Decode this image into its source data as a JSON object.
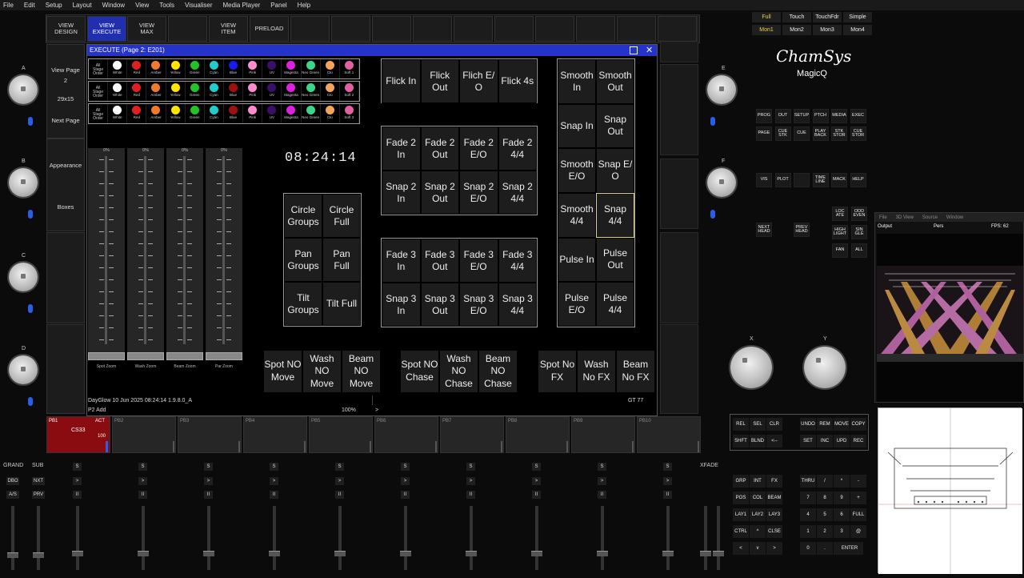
{
  "menu": [
    "File",
    "Edit",
    "Setup",
    "Layout",
    "Window",
    "View",
    "Tools",
    "Visualiser",
    "Media Player",
    "Panel",
    "Help"
  ],
  "top_buttons": [
    {
      "label": "VIEW\nDESIGN",
      "active": false
    },
    {
      "label": "VIEW\nEXECUTE",
      "active": true
    },
    {
      "label": "VIEW\nMAX",
      "active": false
    },
    {
      "label": "",
      "active": false
    },
    {
      "label": "VIEW\nITEM",
      "active": false
    },
    {
      "label": "PRELOAD",
      "active": false
    }
  ],
  "left_panel": {
    "view_page": "View Page",
    "page_num": "2",
    "size": "29x15",
    "next_page": "Next Page",
    "appearance": "Appearance",
    "boxes": "Boxes"
  },
  "encoders_left": [
    "A",
    "B",
    "C",
    "D"
  ],
  "encoders_right": [
    "E",
    "F"
  ],
  "encoders_xy": [
    "X",
    "Y"
  ],
  "exec_window": {
    "title": "EXECUTE (Page 2:  E201)"
  },
  "colour_rows": [
    {
      "first": "All\nStage\nOrder",
      "items": [
        [
          "White",
          "#ffffff"
        ],
        [
          "Red",
          "#e02020"
        ],
        [
          "Amber",
          "#f07a2a"
        ],
        [
          "Yellow",
          "#ffe400"
        ],
        [
          "Green",
          "#22c22a"
        ],
        [
          "Cyan",
          "#22cccc"
        ],
        [
          "Blue",
          "#1a1aee"
        ],
        [
          "Pink",
          "#ff8ccf"
        ],
        [
          "UV",
          "#3a0f6a"
        ],
        [
          "Magenta",
          "#e020e0"
        ],
        [
          "Neo Green",
          "#3cd68a"
        ],
        [
          "Cto",
          "#f5a55a"
        ],
        [
          "Soft 1",
          "#e060a0"
        ]
      ]
    },
    {
      "first": "All\nStage\nOrder",
      "items": [
        [
          "White",
          "#ffffff"
        ],
        [
          "Red",
          "#e02020"
        ],
        [
          "Amber",
          "#f07a2a"
        ],
        [
          "Yellow",
          "#ffe400"
        ],
        [
          "Green",
          "#22c22a"
        ],
        [
          "Cyan",
          "#22cccc"
        ],
        [
          "Blue",
          "#a01010"
        ],
        [
          "Pink",
          "#ff8ccf"
        ],
        [
          "UV",
          "#3a0f6a"
        ],
        [
          "Magenta",
          "#e020e0"
        ],
        [
          "Neo Green",
          "#3cd68a"
        ],
        [
          "Cto",
          "#f5a55a"
        ],
        [
          "Soft 2",
          "#e060a0"
        ]
      ]
    },
    {
      "first": "All\nStage\nOrder",
      "items": [
        [
          "White",
          "#ffffff"
        ],
        [
          "Red",
          "#e02020"
        ],
        [
          "Amber",
          "#f07a2a"
        ],
        [
          "Yellow",
          "#ffe400"
        ],
        [
          "Green",
          "#22c22a"
        ],
        [
          "Cyan",
          "#22cccc"
        ],
        [
          "Blue",
          "#a01010"
        ],
        [
          "Pink",
          "#ff8ccf"
        ],
        [
          "UV",
          "#3a0f6a"
        ],
        [
          "Magenta",
          "#e020e0"
        ],
        [
          "Neo Green",
          "#3cd68a"
        ],
        [
          "Cto",
          "#f5a55a"
        ],
        [
          "Soft 3",
          "#e060a0"
        ]
      ]
    }
  ],
  "faders": [
    {
      "pct": "0%",
      "label": "Spot Zoom"
    },
    {
      "pct": "0%",
      "label": "Wash Zoom"
    },
    {
      "pct": "0%",
      "label": "Beam Zoom"
    },
    {
      "pct": "0%",
      "label": "Par Zoom"
    }
  ],
  "clock": "08:24:14",
  "groups": [
    "Circle\nGroups",
    "Circle\nFull",
    "Pan\nGroups",
    "Pan\nFull",
    "Tilt\nGroups",
    "Tilt Full"
  ],
  "flick": [
    "Flick In",
    "Flick\nOut",
    "Flich E/\nO",
    "Flick 4s"
  ],
  "fade2": [
    "Fade 2\nIn",
    "Fade 2\nOut",
    "Fade 2\nE/O",
    "Fade 2\n4/4",
    "Snap 2\nIn",
    "Snap 2\nOut",
    "Snap 2\nE/O",
    "Snap 2\n4/4"
  ],
  "fade3": [
    "Fade 3\nIn",
    "Fade 3\nOut",
    "Fade 3\nE/O",
    "Fade 3\n4/4",
    "Snap 3\nIn",
    "Snap 3\nOut",
    "Snap 3\nE/O",
    "Snap 3\n4/4"
  ],
  "smooth": [
    "Smooth\nIn",
    "Smooth\nOut",
    "Snap In",
    "Snap\nOut",
    "Smooth\nE/O",
    "Snap E/\nO",
    "Smooth\n4/4",
    "Snap\n4/4",
    "Pulse In",
    "Pulse\nOut",
    "Pulse\nE/O",
    "Pulse\n4/4"
  ],
  "bottom_buttons": [
    "Spot NO\nMove",
    "Wash\nNO\nMove",
    "Beam\nNO\nMove",
    "Spot NO\nChase",
    "Wash\nNO\nChase",
    "Beam\nNO\nChase",
    "Spot No\nFX",
    "Wash\nNo FX",
    "Beam\nNo FX"
  ],
  "status": {
    "left": "DayGlow 10 Jun 2025 08:24:14 1.9.8.0_A",
    "gt": "GT 77",
    "p2": "P2  Add",
    "zoom": "100%",
    "arrow": ">"
  },
  "playbacks": [
    {
      "id": "PB1",
      "act": "ACT",
      "name": "CS33",
      "level": "100"
    },
    {
      "id": "PB2"
    },
    {
      "id": "PB3"
    },
    {
      "id": "PB4"
    },
    {
      "id": "PB5"
    },
    {
      "id": "PB6"
    },
    {
      "id": "PB7"
    },
    {
      "id": "PB8"
    },
    {
      "id": "PB9"
    },
    {
      "id": "PB10"
    }
  ],
  "right_top": [
    [
      "Full",
      "Touch",
      "TouchFdr",
      "Simple"
    ],
    [
      "Mon1",
      "Mon2",
      "Mon3",
      "Mon4"
    ]
  ],
  "brand": {
    "logo": "ChamSys",
    "product": "MagicQ"
  },
  "key_block1": [
    [
      "PROG",
      "OUT",
      "SETUP",
      "PTCH",
      "MEDIA",
      "EXEC"
    ],
    [
      "PAGE",
      "CUE\nSTK",
      "CUE",
      "PLAY\nBACK",
      "STK\nSTOR",
      "CUE\nSTOR"
    ]
  ],
  "key_block2": [
    "VIS",
    "PLOT",
    "",
    "TIME\nLINE",
    "MACK",
    "HELP"
  ],
  "key_block3": {
    "next": "NEXT\nHEAD",
    "prev": "PREV\nHEAD",
    "grid": [
      [
        "LOC\nATE",
        "ODD\nEVEN"
      ],
      [
        "HIGH\nLIGHT",
        "SIN\nGLE"
      ],
      [
        "FAN",
        "ALL"
      ]
    ]
  },
  "bottom_keys": {
    "row1": [
      "REL",
      "SEL",
      "CLR",
      "",
      "UNDO",
      "REM",
      "MOVE",
      "COPY"
    ],
    "row2": [
      "SHFT",
      "BLND",
      "<--",
      "",
      "SET",
      "INC",
      "UPD",
      "REC"
    ]
  },
  "keypad": [
    [
      "GRP",
      "INT",
      "FX",
      "",
      "THRU",
      "/",
      "*",
      "-"
    ],
    [
      "POS",
      "COL",
      "BEAM",
      "",
      "7",
      "8",
      "9",
      "+"
    ],
    [
      "LAY1",
      "LAY2",
      "LAY3",
      "",
      "4",
      "5",
      "6",
      "FULL"
    ],
    [
      "CTRL",
      "^",
      "CLSE",
      "",
      "1",
      "2",
      "3",
      "@"
    ],
    [
      "<",
      "v",
      ">",
      "",
      "0",
      ".",
      "",
      "ENTER"
    ]
  ],
  "bottom_left": {
    "grand": "GRAND",
    "sub": "SUB",
    "dbo": "DBO",
    "nxt": "NXT",
    "as": "A/S",
    "prv": "PRV",
    "xfade": "XFADE"
  },
  "visualiser": {
    "menu": [
      "File",
      "3D View",
      "Source",
      "Window"
    ],
    "output": "Output",
    "pers": "Pers",
    "fps": "FPS: 62"
  },
  "colors": {
    "accent": "#1f2fb0",
    "title": "#2533c8",
    "pb_active": "#8a0c10",
    "highlight": "#d9d27a"
  }
}
